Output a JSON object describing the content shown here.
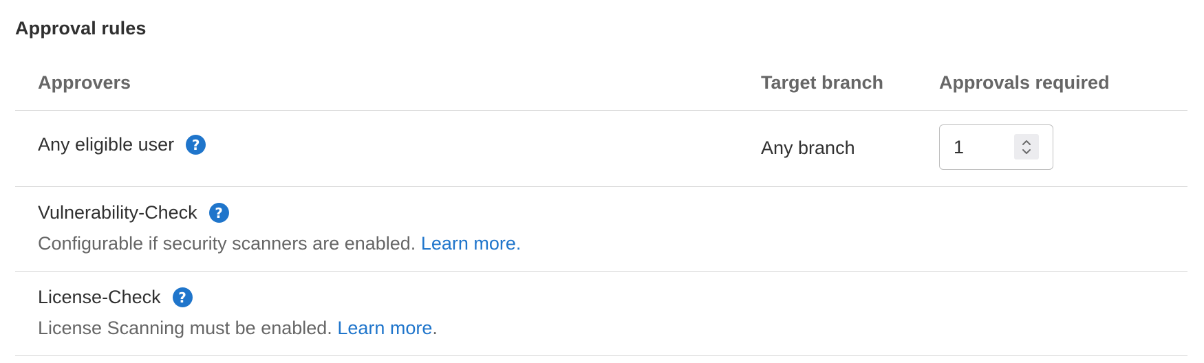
{
  "section": {
    "title": "Approval rules"
  },
  "table": {
    "headers": {
      "approvers": "Approvers",
      "target_branch": "Target branch",
      "approvals_required": "Approvals required"
    },
    "rows": [
      {
        "name": "Any eligible user",
        "target_branch": "Any branch",
        "approvals_required": "1"
      },
      {
        "name": "Vulnerability-Check",
        "description": "Configurable if security scanners are enabled.",
        "link": "Learn more.",
        "suffix": ""
      },
      {
        "name": "License-Check",
        "description": "License Scanning must be enabled.",
        "link": "Learn more",
        "suffix": "."
      }
    ]
  },
  "icons": {
    "help": "question-circle-icon",
    "stepper": "chevron-up-down-icon"
  },
  "colors": {
    "accent": "#1f75cb",
    "text": "#303030",
    "muted": "#666666",
    "border": "#d6d6d6"
  }
}
